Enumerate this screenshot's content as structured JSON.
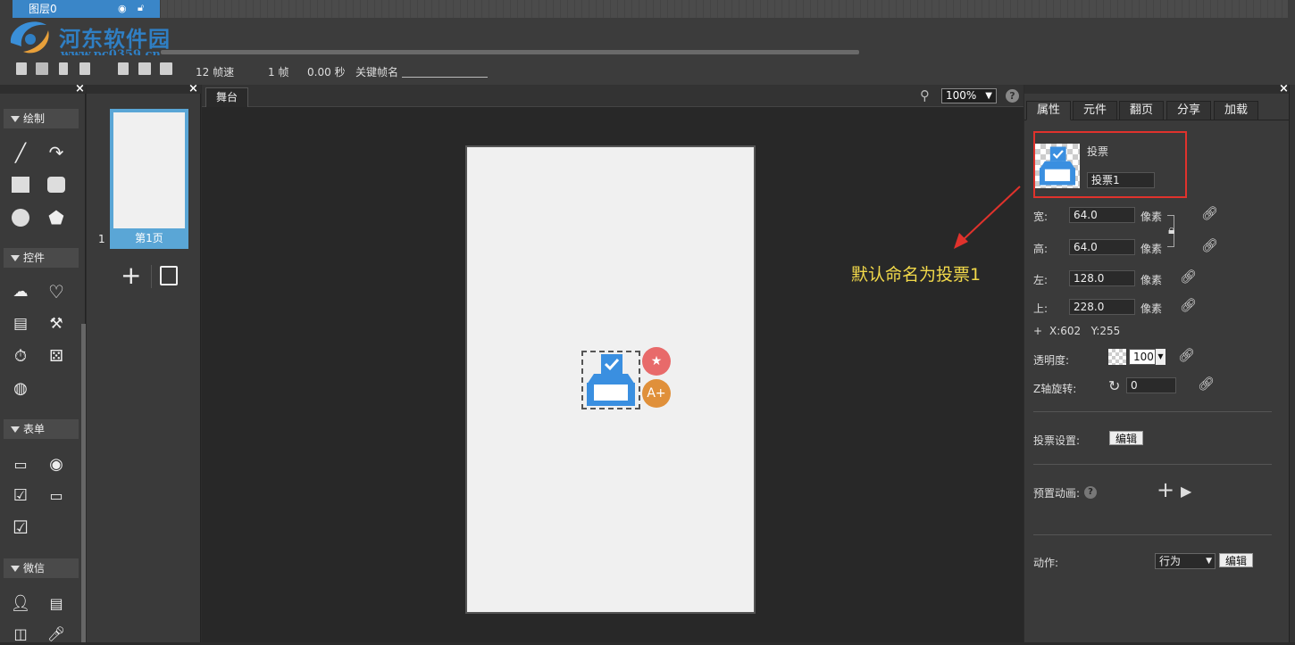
{
  "timeline": {
    "layer_name": "图层0",
    "watermark_title": "河东软件园",
    "watermark_url": "www.pc0359.cn",
    "fps": "12 帧速",
    "frame": "1 帧",
    "seconds": "0.00 秒",
    "keyframe_label": "关键帧名"
  },
  "tools": {
    "sections": [
      {
        "label": "绘制"
      },
      {
        "label": "控件"
      },
      {
        "label": "表单"
      },
      {
        "label": "微信"
      }
    ]
  },
  "pages": {
    "page_number": "1",
    "page_label": "第1页"
  },
  "stage": {
    "tab_label": "舞台",
    "zoom": "100%",
    "annotation": "默认命名为投票1"
  },
  "props": {
    "tabs": [
      "属性",
      "元件",
      "翻页",
      "分享",
      "加载"
    ],
    "component_type": "投票",
    "component_name": "投票1",
    "width_label": "宽:",
    "width_value": "64.0",
    "height_label": "高:",
    "height_value": "64.0",
    "left_label": "左:",
    "left_value": "128.0",
    "top_label": "上:",
    "top_value": "228.0",
    "unit": "像素",
    "coords": "X:602   Y:255",
    "opacity_label": "透明度:",
    "opacity_value": "100",
    "rotate_label": "Z轴旋转:",
    "rotate_value": "0",
    "vote_settings_label": "投票设置:",
    "edit_label": "编辑",
    "preset_anim_label": "预置动画:",
    "action_label": "动作:",
    "action_value": "行为"
  },
  "colors": {
    "accent_blue": "#3a86c8",
    "highlight_red": "#e0322c",
    "annotation_yellow": "#f2d94a",
    "badge_red": "#e86a6a",
    "badge_orange": "#e0903a"
  }
}
